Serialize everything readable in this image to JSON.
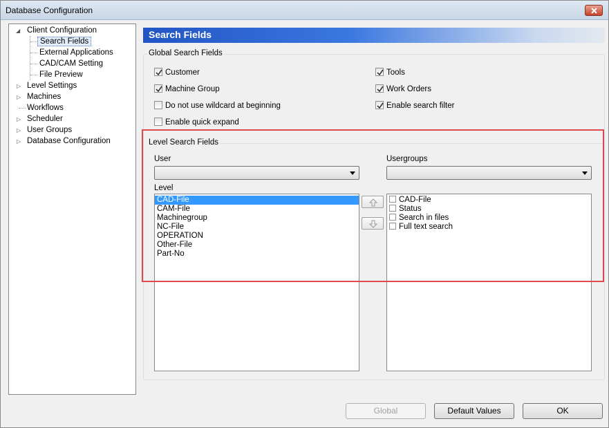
{
  "window": {
    "title": "Database Configuration"
  },
  "tree": {
    "items": [
      {
        "label": "Client Configuration",
        "state": "expanded"
      },
      {
        "label": "Search Fields",
        "state": "selected"
      },
      {
        "label": "External Applications"
      },
      {
        "label": "CAD/CAM Setting"
      },
      {
        "label": "File Preview"
      },
      {
        "label": "Level Settings",
        "state": "collapsed"
      },
      {
        "label": "Machines",
        "state": "collapsed"
      },
      {
        "label": "Workflows"
      },
      {
        "label": "Scheduler",
        "state": "collapsed"
      },
      {
        "label": "User Groups",
        "state": "collapsed"
      },
      {
        "label": "Database Configuration",
        "state": "collapsed"
      }
    ]
  },
  "header": {
    "title": "Search Fields"
  },
  "global_search": {
    "legend": "Global Search Fields",
    "left_options": [
      {
        "label": "Customer",
        "checked": true
      },
      {
        "label": "Machine Group",
        "checked": true
      },
      {
        "label": "Do not use wildcard at beginning",
        "checked": false
      },
      {
        "label": "Enable quick expand",
        "checked": false
      }
    ],
    "right_options": [
      {
        "label": "Tools",
        "checked": true
      },
      {
        "label": "Work Orders",
        "checked": true
      },
      {
        "label": "Enable search filter",
        "checked": true
      }
    ]
  },
  "level_search": {
    "legend": "Level Search Fields",
    "user_label": "User",
    "user_value": "",
    "usergroups_label": "Usergroups",
    "usergroups_value": "",
    "level_label": "Level",
    "levels": [
      "CAD-File",
      "CAM-File",
      "Machinegroup",
      "NC-File",
      "OPERATION",
      "Other-File",
      "Part-No"
    ],
    "selected_level": "CAD-File",
    "fields": [
      {
        "label": "CAD-File",
        "checked": false
      },
      {
        "label": "Status",
        "checked": false
      },
      {
        "label": "Search in files",
        "checked": false
      },
      {
        "label": "Full text search",
        "checked": false
      }
    ]
  },
  "buttons": {
    "global": "Global",
    "default_values": "Default Values",
    "ok": "OK"
  },
  "colors": {
    "header_start": "#2255c4",
    "selection": "#3399ff",
    "highlight_border": "#e0494b"
  }
}
